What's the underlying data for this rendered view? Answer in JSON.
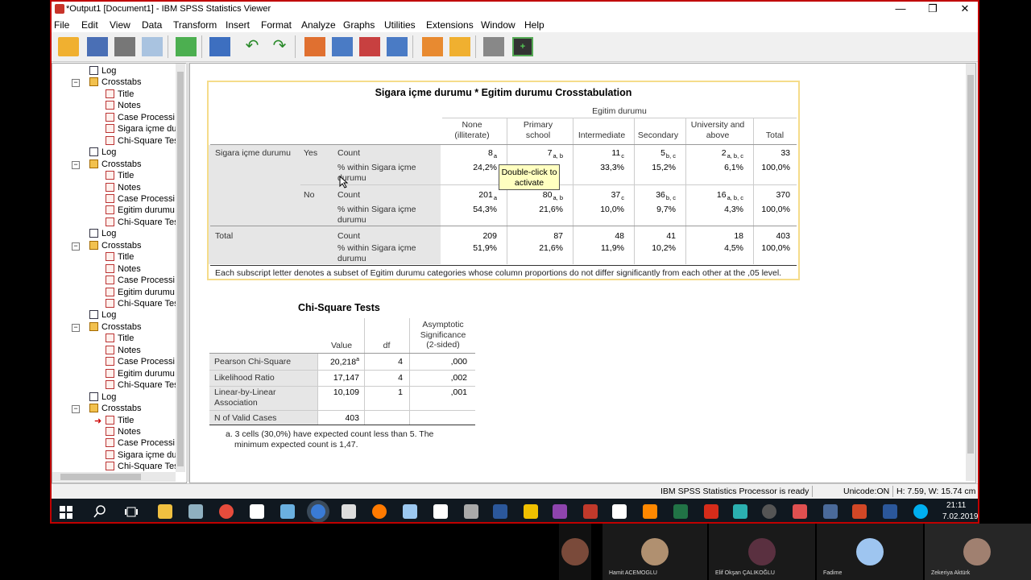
{
  "window": {
    "title": "*Output1 [Document1] - IBM SPSS Statistics Viewer",
    "min": "—",
    "max": "❐",
    "close": "✕"
  },
  "menu": [
    "File",
    "Edit",
    "View",
    "Data",
    "Transform",
    "Insert",
    "Format",
    "Analyze",
    "Graphs",
    "Utilities",
    "Extensions",
    "Window",
    "Help"
  ],
  "outline": [
    {
      "label": "Log",
      "kind": "log",
      "level": 1
    },
    {
      "label": "Crosstabs",
      "kind": "ct",
      "level": 1
    },
    {
      "label": "Title",
      "kind": "pg",
      "level": 2
    },
    {
      "label": "Notes",
      "kind": "pg",
      "level": 2
    },
    {
      "label": "Case Processi",
      "kind": "pg",
      "level": 2
    },
    {
      "label": "Sigara içme du",
      "kind": "pg",
      "level": 2
    },
    {
      "label": "Chi-Square Tes",
      "kind": "pg",
      "level": 2
    },
    {
      "label": "Log",
      "kind": "log",
      "level": 1
    },
    {
      "label": "Crosstabs",
      "kind": "ct",
      "level": 1
    },
    {
      "label": "Title",
      "kind": "pg",
      "level": 2
    },
    {
      "label": "Notes",
      "kind": "pg",
      "level": 2
    },
    {
      "label": "Case Processi",
      "kind": "pg",
      "level": 2
    },
    {
      "label": "Egitim durumu",
      "kind": "pg",
      "level": 2
    },
    {
      "label": "Chi-Square Tes",
      "kind": "pg",
      "level": 2
    },
    {
      "label": "Log",
      "kind": "log",
      "level": 1
    },
    {
      "label": "Crosstabs",
      "kind": "ct",
      "level": 1
    },
    {
      "label": "Title",
      "kind": "pg",
      "level": 2
    },
    {
      "label": "Notes",
      "kind": "pg",
      "level": 2
    },
    {
      "label": "Case Processi",
      "kind": "pg",
      "level": 2
    },
    {
      "label": "Egitim durumu",
      "kind": "pg",
      "level": 2
    },
    {
      "label": "Chi-Square Tes",
      "kind": "pg",
      "level": 2
    },
    {
      "label": "Log",
      "kind": "log",
      "level": 1
    },
    {
      "label": "Crosstabs",
      "kind": "ct",
      "level": 1
    },
    {
      "label": "Title",
      "kind": "pg",
      "level": 2
    },
    {
      "label": "Notes",
      "kind": "pg",
      "level": 2
    },
    {
      "label": "Case Processi",
      "kind": "pg",
      "level": 2
    },
    {
      "label": "Egitim durumu",
      "kind": "pg",
      "level": 2
    },
    {
      "label": "Chi-Square Tes",
      "kind": "pg",
      "level": 2
    },
    {
      "label": "Log",
      "kind": "log",
      "level": 1
    },
    {
      "label": "Crosstabs",
      "kind": "ct",
      "level": 1
    },
    {
      "label": "Title",
      "kind": "pg",
      "level": 2,
      "current": true
    },
    {
      "label": "Notes",
      "kind": "pg",
      "level": 2
    },
    {
      "label": "Case Processi",
      "kind": "pg",
      "level": 2
    },
    {
      "label": "Sigara içme du",
      "kind": "pg",
      "level": 2
    },
    {
      "label": "Chi-Square Tes",
      "kind": "pg",
      "level": 2
    }
  ],
  "crosstab": {
    "title": "Sigara içme durumu * Egitim durumu Crosstabulation",
    "col_group": "Egitim durumu",
    "columns": [
      [
        "None",
        "(illiterate)"
      ],
      [
        "Primary",
        "school"
      ],
      [
        "Intermediate",
        ""
      ],
      [
        "Secondary",
        ""
      ],
      [
        "University and",
        "above"
      ],
      [
        "Total",
        ""
      ]
    ],
    "row_var": "Sigara içme durumu",
    "yes": "Yes",
    "no": "No",
    "total": "Total",
    "count": "Count",
    "within": [
      "% within Sigara içme",
      "durumu"
    ],
    "rows": [
      {
        "vals": [
          "8",
          "7",
          "11",
          "5",
          "2",
          "33"
        ],
        "subs": [
          "a",
          "a, b",
          "c",
          "b, c",
          "a, b, c",
          ""
        ]
      },
      {
        "vals": [
          "24,2%",
          "",
          "33,3%",
          "15,2%",
          "6,1%",
          "100,0%"
        ],
        "subs": [
          "",
          "",
          "",
          "",
          "",
          ""
        ]
      },
      {
        "vals": [
          "201",
          "80",
          "37",
          "36",
          "16",
          "370"
        ],
        "subs": [
          "a",
          "a, b",
          "c",
          "b, c",
          "a, b, c",
          ""
        ]
      },
      {
        "vals": [
          "54,3%",
          "21,6%",
          "10,0%",
          "9,7%",
          "4,3%",
          "100,0%"
        ],
        "subs": [
          "",
          "",
          "",
          "",
          "",
          ""
        ]
      },
      {
        "vals": [
          "209",
          "87",
          "48",
          "41",
          "18",
          "403"
        ],
        "subs": [
          "",
          "",
          "",
          "",
          "",
          ""
        ]
      },
      {
        "vals": [
          "51,9%",
          "21,6%",
          "11,9%",
          "10,2%",
          "4,5%",
          "100,0%"
        ],
        "subs": [
          "",
          "",
          "",
          "",
          "",
          ""
        ]
      }
    ],
    "footnote": "Each subscript letter denotes a subset of Egitim durumu categories whose column proportions do not differ significantly from each other at the ,05 level.",
    "tooltip": [
      "Double-click to",
      "activate"
    ]
  },
  "chisq": {
    "title": "Chi-Square Tests",
    "headers": [
      "Value",
      "df",
      [
        "Asymptotic",
        "Significance",
        "(2-sided)"
      ]
    ],
    "rows": [
      {
        "label": [
          "Pearson Chi-Square",
          ""
        ],
        "value": "20,218",
        "sup": "a",
        "df": "4",
        "sig": ",000"
      },
      {
        "label": [
          "Likelihood Ratio",
          ""
        ],
        "value": "17,147",
        "sup": "",
        "df": "4",
        "sig": ",002"
      },
      {
        "label": [
          "Linear-by-Linear",
          "Association"
        ],
        "value": "10,109",
        "sup": "",
        "df": "1",
        "sig": ",001"
      },
      {
        "label": [
          "N of Valid Cases",
          ""
        ],
        "value": "403",
        "sup": "",
        "df": "",
        "sig": ""
      }
    ],
    "note": [
      "a. 3 cells (30,0%) have expected count less than 5. The",
      "minimum expected count is 1,47."
    ]
  },
  "status": {
    "processor": "IBM SPSS Statistics Processor is ready",
    "unicode": "Unicode:ON",
    "dims": "H: 7.59, W: 15.74 cm"
  },
  "clock": {
    "time": "21:11",
    "date": "7.02.2019"
  },
  "participants": [
    "Hamit ACEMOGLU",
    "Elif Okşan ÇALIKOĞLU",
    "Fadime",
    "Zekeriya Aktürk"
  ],
  "colors": {
    "accent": "#c00000",
    "pivot_border": "#f5dc8a",
    "tooltip": "#ffffc0",
    "taskbar": "#101820"
  }
}
